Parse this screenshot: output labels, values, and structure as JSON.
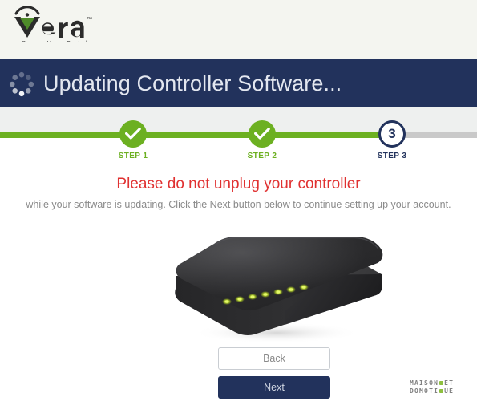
{
  "brand": {
    "name": "vera",
    "trademark": "™",
    "tagline": "Smarter Home Control",
    "logo_icon": "wifi-arc-triangle-icon",
    "green": "#4e8b2a"
  },
  "header": {
    "title": "Updating Controller Software...",
    "spinner_icon": "loading-spinner-icon",
    "background": "#22325c",
    "text_color": "#e3e7f0"
  },
  "progress": {
    "track_color": "#c9c9c9",
    "fill_color": "#6cb021",
    "current_color": "#22325c",
    "steps": [
      {
        "label": "STEP 1",
        "state": "done",
        "value": "1",
        "icon": "check-icon"
      },
      {
        "label": "STEP 2",
        "state": "done",
        "value": "2",
        "icon": "check-icon"
      },
      {
        "label": "STEP 3",
        "state": "current",
        "value": "3",
        "icon": "step-number"
      }
    ]
  },
  "main": {
    "warning": "Please do not unplug your controller",
    "warning_color": "#e03131",
    "subtext": "while your software is updating. Click the Next button below to continue setting up your account.",
    "device_image_name": "vera-controller-device",
    "device_led_count": 7,
    "device_led_color": "#b9d430"
  },
  "buttons": {
    "back": "Back",
    "next": "Next"
  },
  "watermark": {
    "line1_left": "MAISON",
    "line1_right": "ET",
    "line2_left": "DOMOTI",
    "line2_right": "UE",
    "accent": "#7ab51d"
  }
}
